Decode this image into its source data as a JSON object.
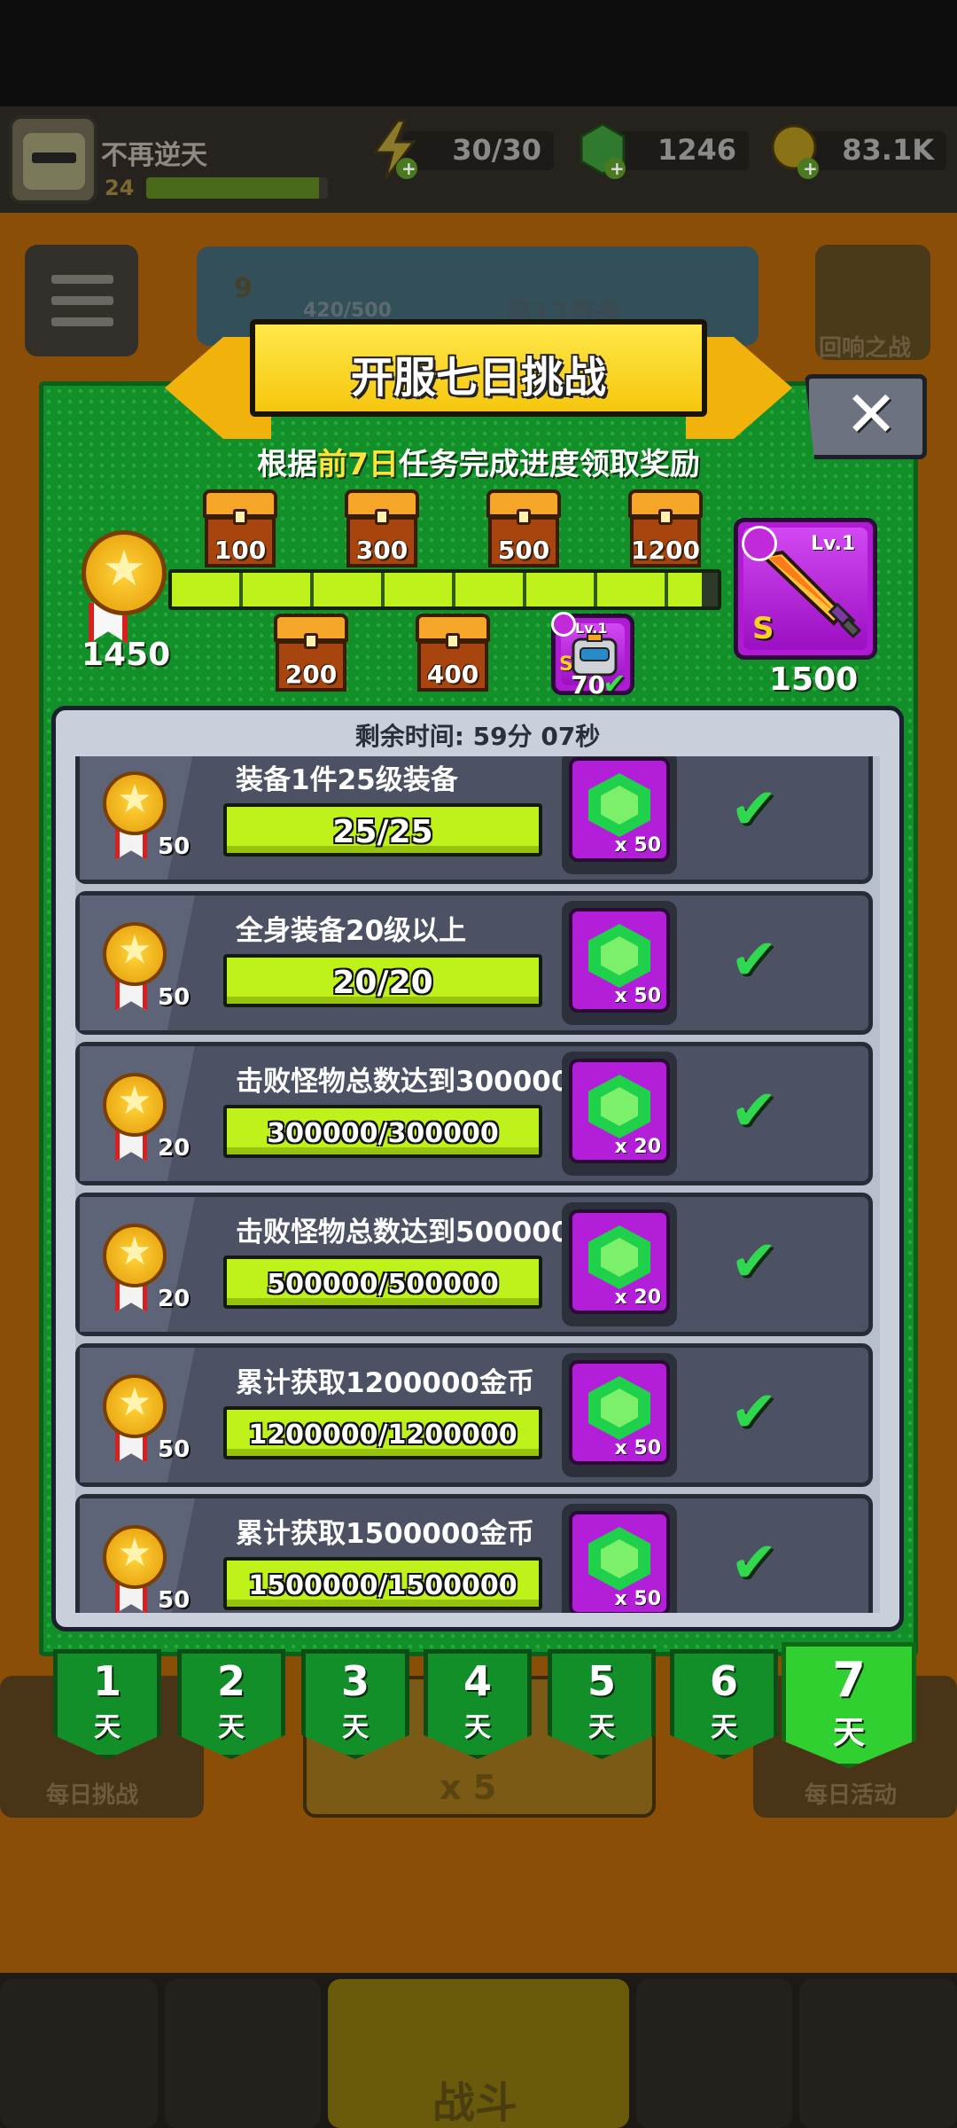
{
  "player": {
    "name": "不再逆天",
    "level": "24"
  },
  "resources": [
    {
      "icon": "energy-icon",
      "value": "30/30"
    },
    {
      "icon": "gem-icon",
      "value": "1246"
    },
    {
      "icon": "gold-coin-icon",
      "value": "83.1K"
    }
  ],
  "background": {
    "season_progress": "420/500",
    "season_level": "9",
    "season_label": "第13赛季",
    "echo_battle": "回响之战",
    "daily_challenge": "每日挑战",
    "daily_event": "每日活动",
    "energy_cost": "x 5",
    "battle": "战斗"
  },
  "dialog": {
    "title": "开服七日挑战",
    "subtitle_pre": "根据",
    "subtitle_highlight": "前7日",
    "subtitle_post": "任务完成进度领取奖励",
    "close_glyph": "✕",
    "total_points": "1450",
    "progress_fraction": 0.97,
    "chests_top": [
      "100",
      "300",
      "500",
      "1200"
    ],
    "chests_bottom": [
      "200",
      "400"
    ],
    "mini_reward": {
      "level": "Lv.1",
      "grade": "S",
      "value": "70"
    },
    "grand_reward": {
      "level": "Lv.1",
      "grade": "S",
      "points": "1500"
    },
    "timer": "剩余时间: 59分 07秒",
    "tasks": [
      {
        "title": "装备1件25级装备",
        "points": "50",
        "progress": "25/25",
        "reward_qty": "x 50"
      },
      {
        "title": "全身装备20级以上",
        "points": "50",
        "progress": "20/20",
        "reward_qty": "x 50"
      },
      {
        "title": "击败怪物总数达到300000",
        "points": "20",
        "progress": "300000/300000",
        "reward_qty": "x 20"
      },
      {
        "title": "击败怪物总数达到500000",
        "points": "20",
        "progress": "500000/500000",
        "reward_qty": "x 20"
      },
      {
        "title": "累计获取1200000金币",
        "points": "50",
        "progress": "1200000/1200000",
        "reward_qty": "x 50"
      },
      {
        "title": "累计获取1500000金币",
        "points": "50",
        "progress": "1500000/1500000",
        "reward_qty": "x 50"
      }
    ],
    "day_tabs": [
      {
        "num": "1",
        "unit": "天"
      },
      {
        "num": "2",
        "unit": "天"
      },
      {
        "num": "3",
        "unit": "天"
      },
      {
        "num": "4",
        "unit": "天"
      },
      {
        "num": "5",
        "unit": "天"
      },
      {
        "num": "6",
        "unit": "天"
      },
      {
        "num": "7",
        "unit": "天"
      }
    ],
    "active_day": "7"
  },
  "colors": {
    "panel_green": "#138f2a",
    "progress_lime": "#bff21a",
    "gem_tile_purple": "#b31ed8",
    "check_green": "#2fd84e"
  }
}
